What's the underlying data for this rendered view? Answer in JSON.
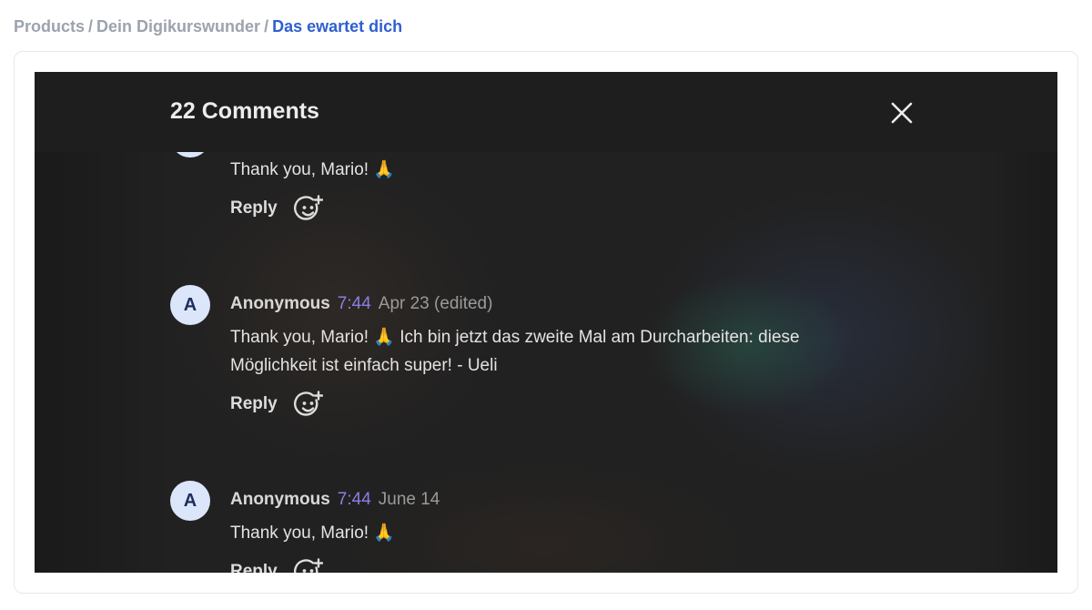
{
  "breadcrumb": {
    "items": [
      "Products",
      "Dein Digikurswunder"
    ],
    "current": "Das ewartet dich",
    "separator": "/"
  },
  "comments_panel": {
    "title": "22 Comments",
    "close_icon": "close-icon",
    "reply_label": "Reply",
    "reaction_icon": "add-reaction-icon",
    "comments": [
      {
        "text": "Thank you, Mario! 🙏"
      },
      {
        "avatar_letter": "A",
        "author": "Anonymous",
        "timestamp": "7:44",
        "date": "Apr 23 (edited)",
        "text": "Thank you, Mario! 🙏 Ich bin jetzt das zweite Mal am Durcharbeiten: diese Möglichkeit ist einfach super! - Ueli"
      },
      {
        "avatar_letter": "A",
        "author": "Anonymous",
        "timestamp": "7:44",
        "date": "June 14",
        "text": "Thank you, Mario! 🙏"
      }
    ]
  },
  "colors": {
    "breadcrumb_link": "#9ca3af",
    "breadcrumb_current": "#2f5fd0",
    "panel_bg": "#212121",
    "timestamp": "#8b7fe6",
    "avatar_bg": "#dbe6fb"
  }
}
